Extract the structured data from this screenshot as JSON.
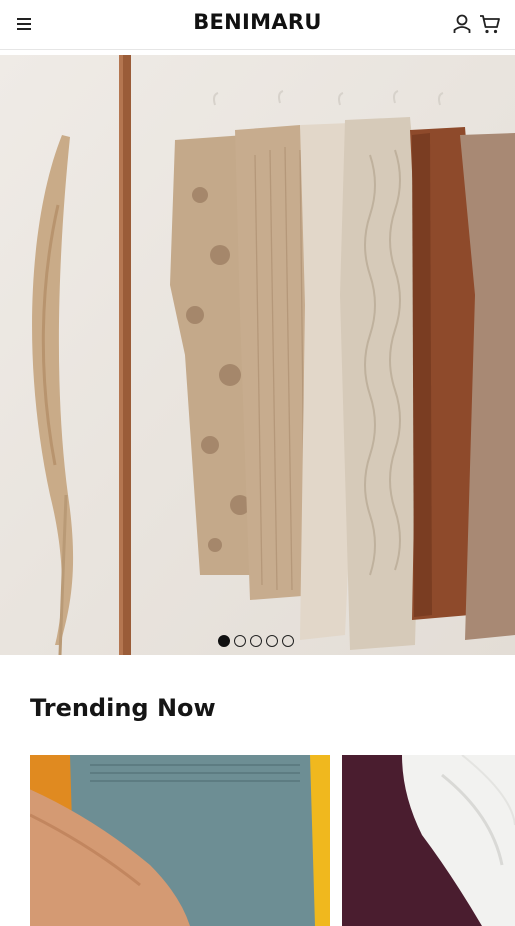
{
  "header": {
    "logo": "BENIMARU",
    "icons": {
      "menu": "hamburger-menu-icon",
      "account": "user-icon",
      "cart": "cart-icon"
    }
  },
  "hero": {
    "image": "clothing-rack-with-sweaters-and-pampas-grass",
    "slides_total": 5,
    "active_slide": 1
  },
  "trending": {
    "title": "Trending Now",
    "products": [
      {
        "image": "person-in-blue-shorts-yellow-top"
      },
      {
        "image": "white-dress-shirt-on-burgundy-fabric"
      }
    ]
  },
  "colors": {
    "background": "#ffffff",
    "text": "#111111",
    "hero_bg": "#ede9e4"
  }
}
